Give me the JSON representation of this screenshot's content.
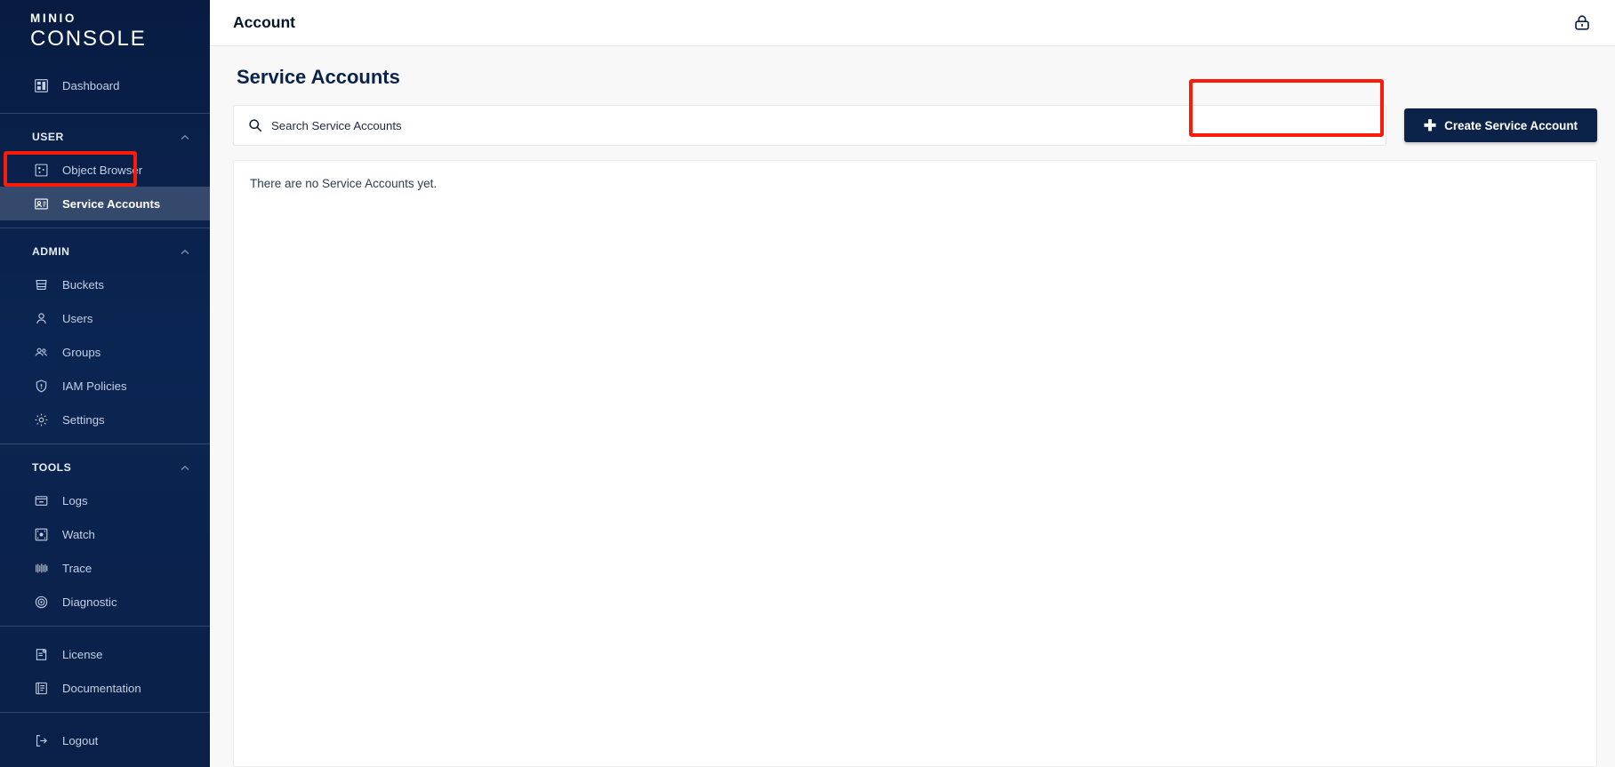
{
  "brand": {
    "logo_top": "MINIO",
    "logo_bottom": "CONSOLE"
  },
  "topbar": {
    "title": "Account",
    "lock_icon": "lock-icon"
  },
  "sidebar": {
    "dashboard": {
      "label": "Dashboard",
      "icon": "dashboard-icon"
    },
    "sections": [
      {
        "title": "USER",
        "collapse_icon": "chevron-up-icon",
        "items": [
          {
            "label": "Object Browser",
            "icon": "object-browser-icon",
            "selected": false
          },
          {
            "label": "Service Accounts",
            "icon": "service-accounts-icon",
            "selected": true
          }
        ]
      },
      {
        "title": "ADMIN",
        "collapse_icon": "chevron-up-icon",
        "items": [
          {
            "label": "Buckets",
            "icon": "bucket-icon",
            "selected": false
          },
          {
            "label": "Users",
            "icon": "user-icon",
            "selected": false
          },
          {
            "label": "Groups",
            "icon": "groups-icon",
            "selected": false
          },
          {
            "label": "IAM Policies",
            "icon": "shield-icon",
            "selected": false
          },
          {
            "label": "Settings",
            "icon": "gear-icon",
            "selected": false
          }
        ]
      },
      {
        "title": "TOOLS",
        "collapse_icon": "chevron-up-icon",
        "items": [
          {
            "label": "Logs",
            "icon": "logs-icon",
            "selected": false
          },
          {
            "label": "Watch",
            "icon": "watch-icon",
            "selected": false
          },
          {
            "label": "Trace",
            "icon": "trace-icon",
            "selected": false
          },
          {
            "label": "Diagnostic",
            "icon": "diagnostic-icon",
            "selected": false
          }
        ]
      }
    ],
    "footer_items": [
      {
        "label": "License",
        "icon": "license-icon"
      },
      {
        "label": "Documentation",
        "icon": "documentation-icon"
      }
    ],
    "logout": {
      "label": "Logout",
      "icon": "logout-icon"
    }
  },
  "main": {
    "page_title": "Service Accounts",
    "search": {
      "placeholder": "Search Service Accounts",
      "value": "",
      "icon": "search-icon"
    },
    "create_button": {
      "label": "Create Service Account",
      "icon": "plus-icon"
    },
    "empty_state": "There are no Service Accounts yet."
  },
  "colors": {
    "sidebar_top": "#081c42",
    "sidebar_bottom": "#0a2048",
    "selected_item": "#34496b",
    "accent_button": "#0b2349",
    "annotation": "#fb1b09",
    "page_bg": "#f8f8f8"
  }
}
